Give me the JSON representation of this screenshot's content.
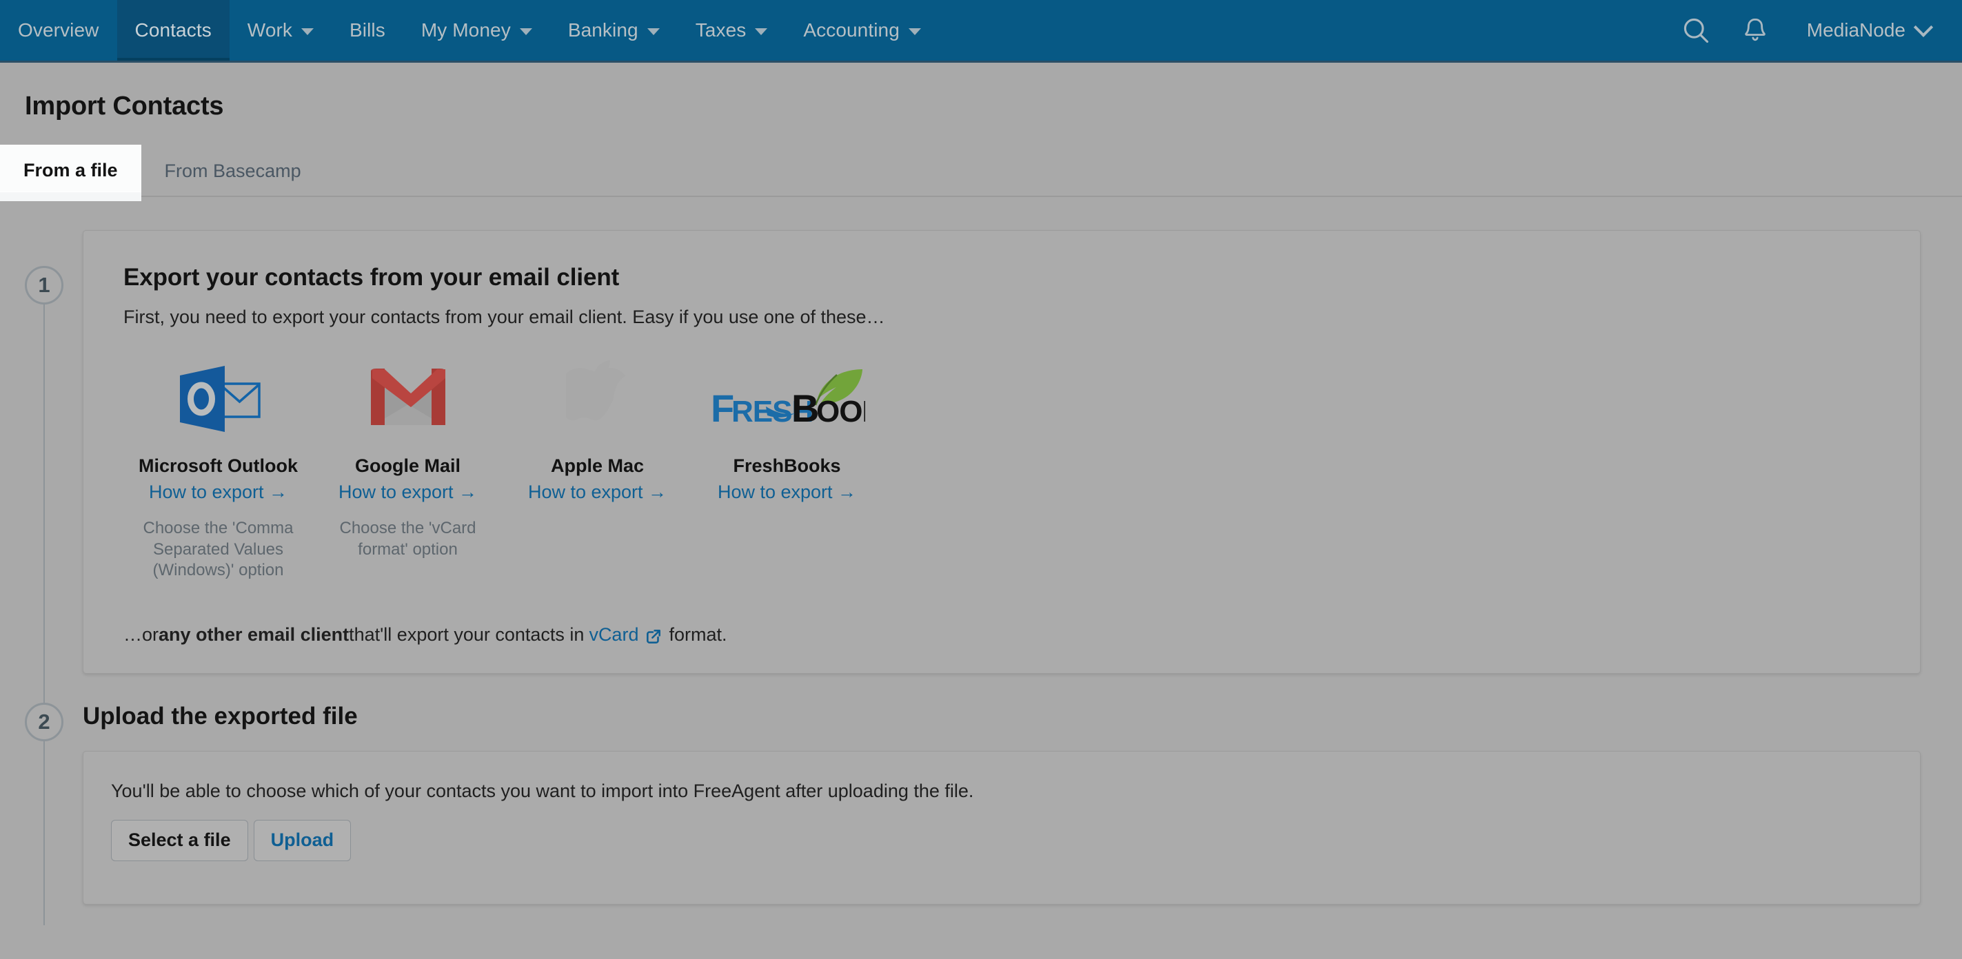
{
  "navbar": {
    "items": [
      {
        "label": "Overview",
        "has_caret": false,
        "active": false
      },
      {
        "label": "Contacts",
        "has_caret": false,
        "active": true
      },
      {
        "label": "Work",
        "has_caret": true,
        "active": false
      },
      {
        "label": "Bills",
        "has_caret": false,
        "active": false
      },
      {
        "label": "My Money",
        "has_caret": true,
        "active": false
      },
      {
        "label": "Banking",
        "has_caret": true,
        "active": false
      },
      {
        "label": "Taxes",
        "has_caret": true,
        "active": false
      },
      {
        "label": "Accounting",
        "has_caret": true,
        "active": false
      }
    ],
    "search_icon": "search-icon",
    "notifications_icon": "bell-icon",
    "user": "MediaNode",
    "user_caret_icon": "chevron-down-icon",
    "brand_color": "#075985"
  },
  "page": {
    "title": "Import Contacts"
  },
  "tabs": [
    {
      "label": "From a file",
      "active": true
    },
    {
      "label": "From Basecamp",
      "active": false
    }
  ],
  "step1": {
    "number": "1",
    "heading": "Export your contacts from your email client",
    "subheading": "First, you need to export your contacts from your email client. Easy if you use one of these…",
    "providers": [
      {
        "logo": "microsoft-outlook-logo",
        "name": "Microsoft Outlook",
        "link": "How to export →",
        "note": "Choose the 'Comma Separated Values (Windows)' option"
      },
      {
        "logo": "google-mail-logo",
        "name": "Google Mail",
        "link": "How to export →",
        "note": "Choose the 'vCard format' option"
      },
      {
        "logo": "apple-logo",
        "name": "Apple Mac",
        "link": "How to export →",
        "note": ""
      },
      {
        "logo": "freshbooks-logo",
        "name": "FreshBooks",
        "link": "How to export →",
        "note": ""
      }
    ],
    "other_prefix": "…or ",
    "other_bold": "any other email client",
    "other_middle": " that'll export your contacts in ",
    "other_link": "vCard",
    "other_suffix": "format."
  },
  "step2": {
    "number": "2",
    "heading": "Upload the exported file",
    "description": "You'll be able to choose which of your contacts you want to import into FreeAgent after uploading the file.",
    "select_button": "Select a file",
    "upload_button": "Upload"
  },
  "colors": {
    "nav_background": "#075985",
    "nav_active": "#0a4d74",
    "link": "#0f5f93",
    "tab_underline": "#1271b5",
    "page_background": "#a9a9a9",
    "card_background": "#ababab"
  }
}
